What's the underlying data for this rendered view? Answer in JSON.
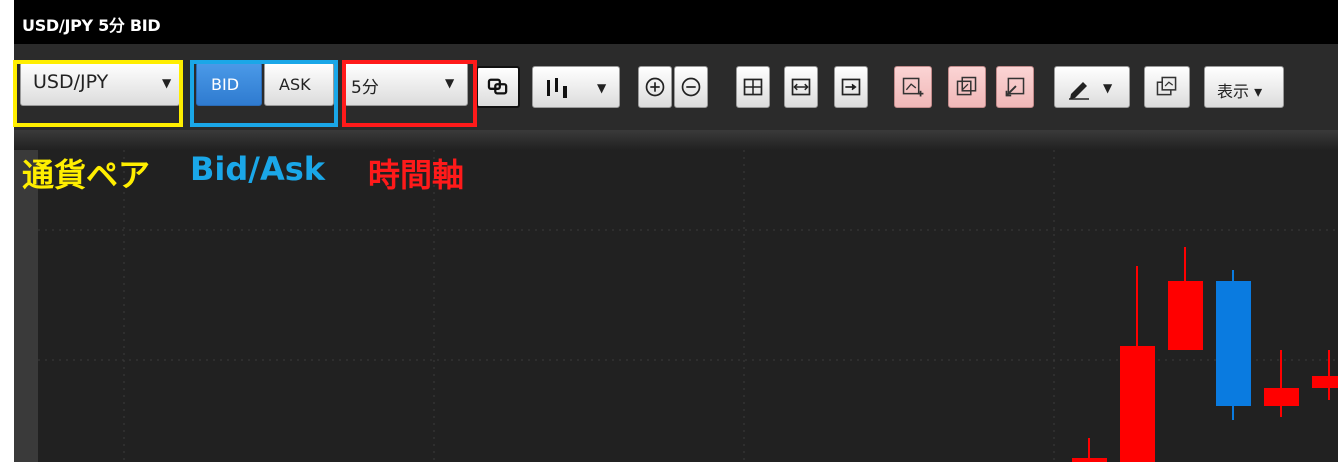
{
  "window": {
    "title": "USD/JPY 5分 BID"
  },
  "toolbar": {
    "pair_select": {
      "value": "USD/JPY"
    },
    "bid_button": {
      "label": "BID",
      "active": true
    },
    "ask_button": {
      "label": "ASK"
    },
    "timeframe_select": {
      "value": "5分"
    },
    "display_menu": {
      "label": "表示 ▾"
    }
  },
  "annotations": {
    "pair_label": "通貨ペア",
    "bidask_label": "Bid/Ask",
    "timeframe_label": "時間軸",
    "colors": {
      "pair": "#ffee00",
      "bidask": "#1aa7e8",
      "timeframe": "#ff1a1a"
    }
  },
  "chart_data": {
    "type": "candlestick",
    "colors": {
      "up": "#ff0000",
      "down": "#0a7be0",
      "background": "#212121",
      "grid": "#3c3c3c"
    },
    "candles": [
      {
        "direction": "up"
      },
      {
        "direction": "up"
      },
      {
        "direction": "up"
      },
      {
        "direction": "down"
      },
      {
        "direction": "up"
      },
      {
        "direction": "up"
      }
    ]
  }
}
